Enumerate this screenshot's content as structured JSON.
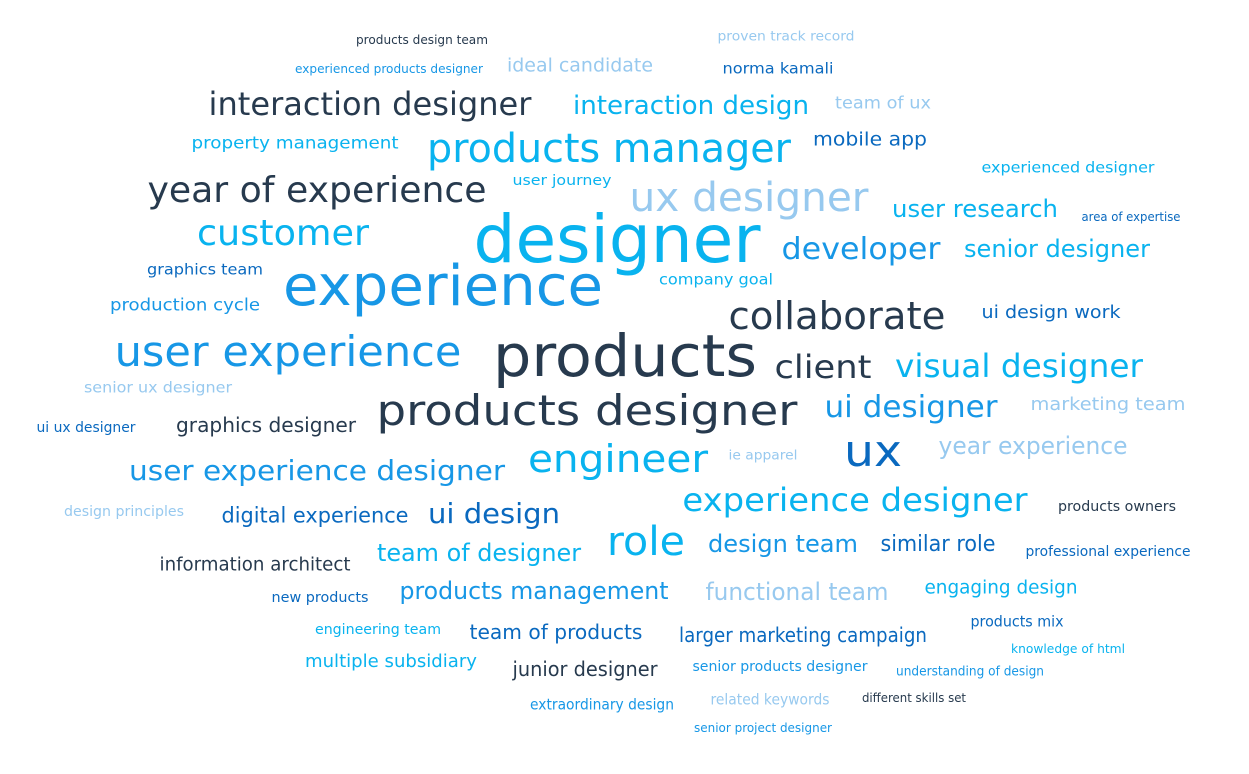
{
  "colors": {
    "dark": "#273a4e",
    "cyan": "#09b3ef",
    "blue": "#0a69bf",
    "light": "#97c9ef",
    "mid": "#1797e6"
  },
  "words": [
    {
      "text": "products design team",
      "color": "dark"
    },
    {
      "text": "proven track record",
      "color": "light"
    },
    {
      "text": "experienced products designer",
      "color": "mid"
    },
    {
      "text": "ideal candidate",
      "color": "light"
    },
    {
      "text": "norma kamali",
      "color": "blue"
    },
    {
      "text": "interaction designer",
      "color": "dark"
    },
    {
      "text": "interaction design",
      "color": "cyan"
    },
    {
      "text": "team of ux",
      "color": "light"
    },
    {
      "text": "property management",
      "color": "cyan"
    },
    {
      "text": "products manager",
      "color": "cyan"
    },
    {
      "text": "mobile app",
      "color": "blue"
    },
    {
      "text": "experienced designer",
      "color": "cyan"
    },
    {
      "text": "year of experience",
      "color": "dark"
    },
    {
      "text": "user journey",
      "color": "cyan"
    },
    {
      "text": "ux designer",
      "color": "light"
    },
    {
      "text": "user research",
      "color": "cyan"
    },
    {
      "text": "area of expertise",
      "color": "blue"
    },
    {
      "text": "customer",
      "color": "cyan"
    },
    {
      "text": "designer",
      "color": "cyan"
    },
    {
      "text": "developer",
      "color": "mid"
    },
    {
      "text": "senior designer",
      "color": "cyan"
    },
    {
      "text": "graphics team",
      "color": "blue"
    },
    {
      "text": "experience",
      "color": "mid"
    },
    {
      "text": "company goal",
      "color": "cyan"
    },
    {
      "text": "production cycle",
      "color": "mid"
    },
    {
      "text": "collaborate",
      "color": "dark"
    },
    {
      "text": "ui design work",
      "color": "blue"
    },
    {
      "text": "user experience",
      "color": "mid"
    },
    {
      "text": "products",
      "color": "dark"
    },
    {
      "text": "client",
      "color": "dark"
    },
    {
      "text": "visual designer",
      "color": "cyan"
    },
    {
      "text": "senior ux designer",
      "color": "light"
    },
    {
      "text": "graphics designer",
      "color": "dark"
    },
    {
      "text": "products designer",
      "color": "dark"
    },
    {
      "text": "ui designer",
      "color": "mid"
    },
    {
      "text": "marketing team",
      "color": "light"
    },
    {
      "text": "ui ux designer",
      "color": "blue"
    },
    {
      "text": "ux",
      "color": "blue"
    },
    {
      "text": "year experience",
      "color": "light"
    },
    {
      "text": "ie apparel",
      "color": "light"
    },
    {
      "text": "user experience designer",
      "color": "mid"
    },
    {
      "text": "engineer",
      "color": "cyan"
    },
    {
      "text": "experience designer",
      "color": "cyan"
    },
    {
      "text": "design principles",
      "color": "light"
    },
    {
      "text": "digital experience",
      "color": "blue"
    },
    {
      "text": "ui design",
      "color": "blue"
    },
    {
      "text": "products owners",
      "color": "dark"
    },
    {
      "text": "role",
      "color": "cyan"
    },
    {
      "text": "design team",
      "color": "mid"
    },
    {
      "text": "similar role",
      "color": "blue"
    },
    {
      "text": "professional experience",
      "color": "blue"
    },
    {
      "text": "information architect",
      "color": "dark"
    },
    {
      "text": "team of designer",
      "color": "cyan"
    },
    {
      "text": "new products",
      "color": "blue"
    },
    {
      "text": "products management",
      "color": "mid"
    },
    {
      "text": "functional team",
      "color": "light"
    },
    {
      "text": "engaging design",
      "color": "cyan"
    },
    {
      "text": "engineering team",
      "color": "cyan"
    },
    {
      "text": "team of products",
      "color": "blue"
    },
    {
      "text": "larger marketing campaign",
      "color": "blue"
    },
    {
      "text": "products mix",
      "color": "blue"
    },
    {
      "text": "knowledge of html",
      "color": "cyan"
    },
    {
      "text": "multiple subsidiary",
      "color": "cyan"
    },
    {
      "text": "junior designer",
      "color": "dark"
    },
    {
      "text": "senior products designer",
      "color": "mid"
    },
    {
      "text": "understanding of design",
      "color": "mid"
    },
    {
      "text": "related keywords",
      "color": "light"
    },
    {
      "text": "different skills set",
      "color": "dark"
    },
    {
      "text": "extraordinary design",
      "color": "mid"
    },
    {
      "text": "senior project designer",
      "color": "mid"
    }
  ]
}
